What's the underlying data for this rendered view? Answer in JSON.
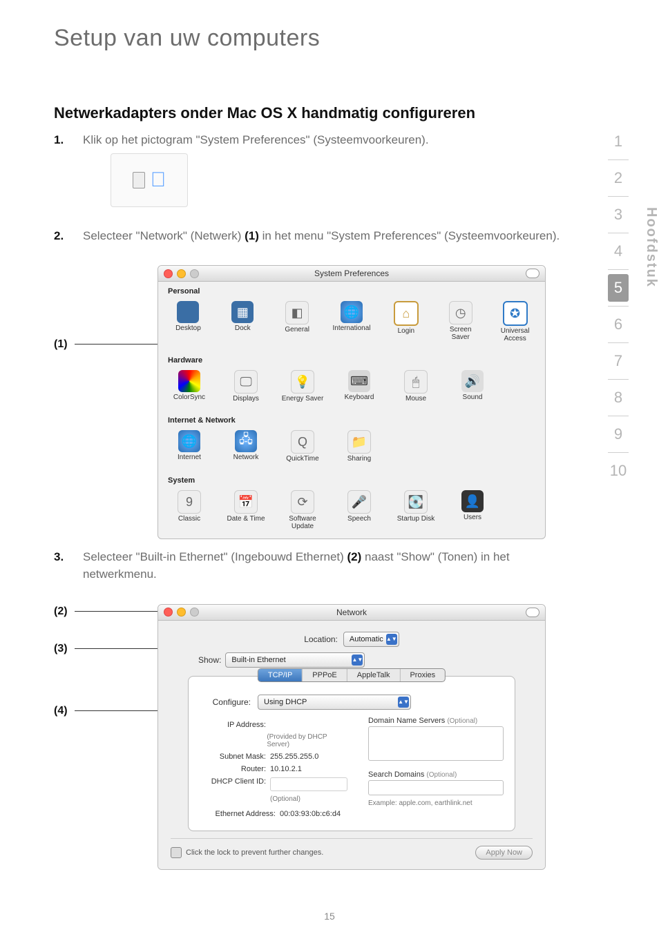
{
  "page": {
    "title": "Setup van uw computers",
    "number": "15"
  },
  "sidebar": {
    "chapters": [
      "1",
      "2",
      "3",
      "4",
      "5",
      "6",
      "7",
      "8",
      "9",
      "10"
    ],
    "active_index": 4,
    "label": "Hoofdstuk"
  },
  "section": {
    "heading": "Netwerkadapters onder Mac OS X handmatig configureren"
  },
  "steps": {
    "s1": {
      "num": "1.",
      "text": "Klik op het pictogram \"System Preferences\" (Systeemvoorkeuren)."
    },
    "s2": {
      "num": "2.",
      "text_a": "Selecteer \"Network\" (Netwerk) ",
      "bold": "(1)",
      "text_b": " in het menu \"System Preferences\" (Systeemvoorkeuren)."
    },
    "s3": {
      "num": "3.",
      "text_a": "Selecteer \"Built-in Ethernet\" (Ingebouwd Ethernet) ",
      "bold": "(2)",
      "text_b": " naast \"Show\" (Tonen) in het netwerkmenu."
    }
  },
  "sysprefs": {
    "title": "System Preferences",
    "sections": {
      "personal": {
        "heading": "Personal",
        "items": [
          "Desktop",
          "Dock",
          "General",
          "International",
          "Login",
          "Screen Saver",
          "Universal Access"
        ]
      },
      "hardware": {
        "heading": "Hardware",
        "items": [
          "ColorSync",
          "Displays",
          "Energy Saver",
          "Keyboard",
          "Mouse",
          "Sound"
        ]
      },
      "internet": {
        "heading": "Internet & Network",
        "items": [
          "Internet",
          "Network",
          "QuickTime",
          "Sharing"
        ]
      },
      "system": {
        "heading": "System",
        "items": [
          "Classic",
          "Date & Time",
          "Software Update",
          "Speech",
          "Startup Disk",
          "Users"
        ]
      }
    }
  },
  "network": {
    "title": "Network",
    "location_label": "Location:",
    "location_value": "Automatic",
    "show_label": "Show:",
    "show_value": "Built-in Ethernet",
    "tabs": [
      "TCP/IP",
      "PPPoE",
      "AppleTalk",
      "Proxies"
    ],
    "tabs_active": 0,
    "configure_label": "Configure:",
    "configure_value": "Using DHCP",
    "left": {
      "ip_label": "IP Address:",
      "ip_note": "(Provided by DHCP Server)",
      "subnet_label": "Subnet Mask:",
      "subnet_value": "255.255.255.0",
      "router_label": "Router:",
      "router_value": "10.10.2.1",
      "client_label": "DHCP Client ID:",
      "client_note": "(Optional)",
      "eth_label": "Ethernet Address:",
      "eth_value": "00:03:93:0b:c6:d4"
    },
    "right": {
      "dns_heading": "Domain Name Servers",
      "dns_opt": "(Optional)",
      "search_heading": "Search Domains",
      "search_opt": "(Optional)",
      "example": "Example: apple.com, earthlink.net"
    },
    "lock_text": "Click the lock to prevent further changes.",
    "apply": "Apply Now"
  },
  "callouts": {
    "c1": "(1)",
    "c2": "(2)",
    "c3": "(3)",
    "c4": "(4)"
  }
}
